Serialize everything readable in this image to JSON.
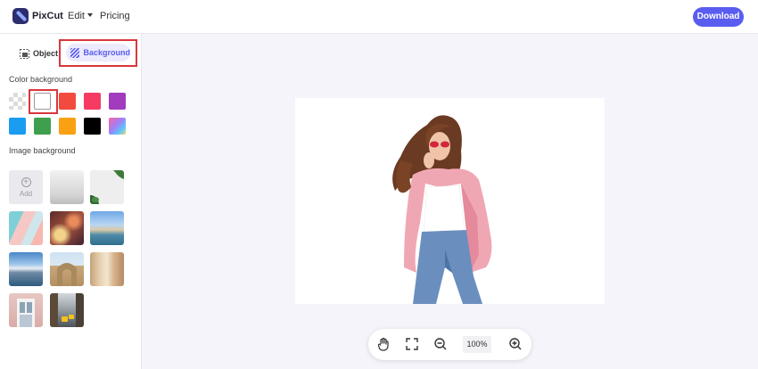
{
  "header": {
    "brand": "PixCut",
    "nav": {
      "edit_label": "Edit",
      "pricing_label": "Pricing"
    },
    "download_label": "Download"
  },
  "sidebar": {
    "tabs": {
      "object_label": "Object",
      "background_label": "Background",
      "active": "Background"
    },
    "color_section": {
      "title": "Color background",
      "selected": "#ffffff",
      "swatches": [
        "transparent",
        "#ffffff",
        "#f24b3d",
        "#f53b62",
        "#a23bbd",
        "#1a9cf0",
        "#3ea04e",
        "#f9a113",
        "#000000",
        "gradient"
      ]
    },
    "image_section": {
      "title": "Image background",
      "add_label": "Add"
    }
  },
  "toolbar": {
    "zoom": "100%",
    "icons": [
      "hand-icon",
      "fit-screen-icon",
      "zoom-out-icon",
      "zoom-in-icon"
    ]
  },
  "colors": {
    "accent": "#5a5cf0",
    "highlight": "#d9373d"
  }
}
